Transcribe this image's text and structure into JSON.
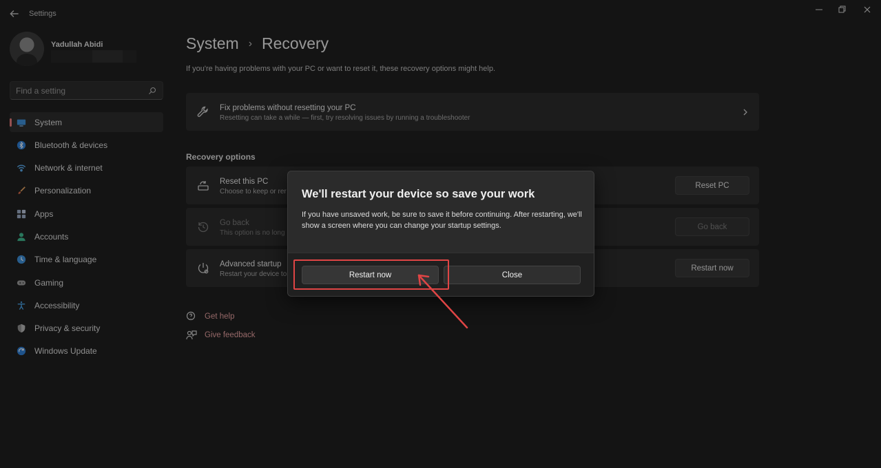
{
  "window": {
    "title": "Settings"
  },
  "profile": {
    "name": "Yadullah Abidi"
  },
  "search": {
    "placeholder": "Find a setting"
  },
  "sidebar": {
    "items": [
      {
        "label": "System",
        "icon": "monitor-icon",
        "active": true
      },
      {
        "label": "Bluetooth & devices",
        "icon": "bluetooth-icon"
      },
      {
        "label": "Network & internet",
        "icon": "wifi-icon"
      },
      {
        "label": "Personalization",
        "icon": "brush-icon"
      },
      {
        "label": "Apps",
        "icon": "apps-icon"
      },
      {
        "label": "Accounts",
        "icon": "person-icon"
      },
      {
        "label": "Time & language",
        "icon": "globe-clock-icon"
      },
      {
        "label": "Gaming",
        "icon": "gamepad-icon"
      },
      {
        "label": "Accessibility",
        "icon": "accessibility-icon"
      },
      {
        "label": "Privacy & security",
        "icon": "shield-icon"
      },
      {
        "label": "Windows Update",
        "icon": "update-icon"
      }
    ]
  },
  "breadcrumb": {
    "parent": "System",
    "separator": "›",
    "current": "Recovery"
  },
  "page": {
    "subtitle": "If you're having problems with your PC or want to reset it, these recovery options might help."
  },
  "fix_card": {
    "title": "Fix problems without resetting your PC",
    "desc": "Resetting can take a while — first, try resolving issues by running a troubleshooter"
  },
  "recovery": {
    "heading": "Recovery options",
    "reset": {
      "title": "Reset this PC",
      "desc": "Choose to keep or rer",
      "button": "Reset PC"
    },
    "goback": {
      "title": "Go back",
      "desc": "This option is no long",
      "button": "Go back"
    },
    "advanced": {
      "title": "Advanced startup",
      "desc": "Restart your device to",
      "button": "Restart now"
    }
  },
  "links": {
    "help": "Get help",
    "feedback": "Give feedback"
  },
  "dialog": {
    "title": "We'll restart your device so save your work",
    "body": "If you have unsaved work, be sure to save it before continuing. After restarting, we'll show a screen where you can change your startup settings.",
    "primary": "Restart now",
    "secondary": "Close"
  },
  "colors": {
    "accent": "#e57c7c",
    "annotation": "#e04545",
    "link": "#e5a0a0",
    "background": "#1f1f1f"
  }
}
